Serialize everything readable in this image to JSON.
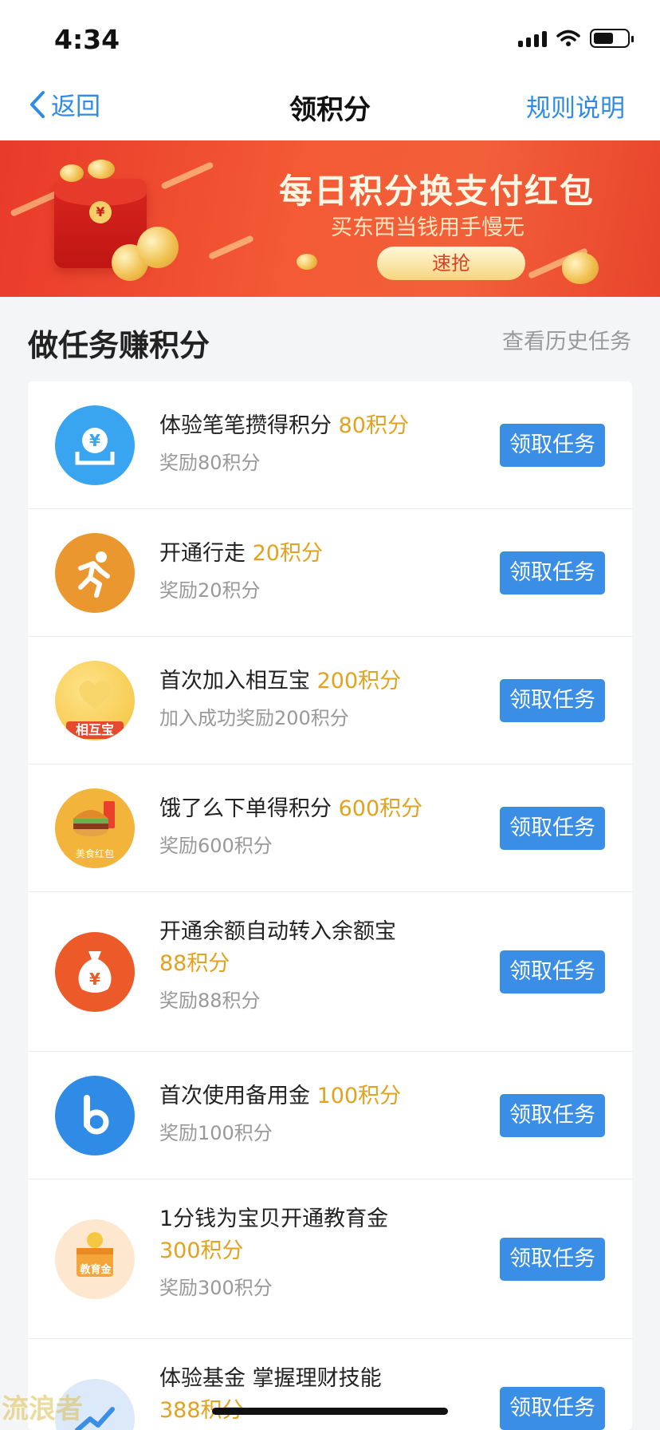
{
  "status_bar": {
    "time": "4:34"
  },
  "nav": {
    "back_label": "返回",
    "title": "领积分",
    "rules_label": "规则说明"
  },
  "banner": {
    "title": "每日积分换支付红包",
    "subtitle": "买东西当钱用手慢无",
    "button_label": "速抢",
    "envelope_symbol": "¥"
  },
  "section": {
    "title": "做任务赚积分",
    "history_label": "查看历史任务"
  },
  "tasks": [
    {
      "title": "体验笔笔攒得积分",
      "points": "80积分",
      "desc": "奖励80积分",
      "button": "领取任务",
      "icon": "savings-icon",
      "icon_color": "#39a5f0"
    },
    {
      "title": "开通行走",
      "points": "20积分",
      "desc": "奖励20积分",
      "button": "领取任务",
      "icon": "running-icon",
      "icon_color": "#e9972e"
    },
    {
      "title": "首次加入相互宝",
      "points": "200积分",
      "desc": "加入成功奖励200积分",
      "button": "领取任务",
      "icon": "xianghubao-icon",
      "icon_color": "#f5c844",
      "icon_label": "相互宝"
    },
    {
      "title": "饿了么下单得积分",
      "points": "600积分",
      "desc": "奖励600积分",
      "button": "领取任务",
      "icon": "food-redpacket-icon",
      "icon_color": "#f2b43a",
      "icon_label": "美食红包"
    },
    {
      "title": "开通余额自动转入余额宝",
      "points": "88积分",
      "desc": "奖励88积分",
      "button": "领取任务",
      "icon": "money-bag-icon",
      "icon_color": "#ec5a2a"
    },
    {
      "title": "首次使用备用金",
      "points": "100积分",
      "desc": "奖励100积分",
      "button": "领取任务",
      "icon": "beiyongjin-icon",
      "icon_color": "#2f8be6"
    },
    {
      "title": "1分钱为宝贝开通教育金",
      "points": "300积分",
      "desc": "奖励300积分",
      "button": "领取任务",
      "icon": "education-fund-icon",
      "icon_color": "#f4a63a",
      "icon_label": "教育金"
    },
    {
      "title": "体验基金 掌握理财技能",
      "points": "388积分",
      "desc": "",
      "button": "领取任务",
      "icon": "fund-icon",
      "icon_color": "#3a8ee6"
    }
  ],
  "watermark": "流浪者"
}
